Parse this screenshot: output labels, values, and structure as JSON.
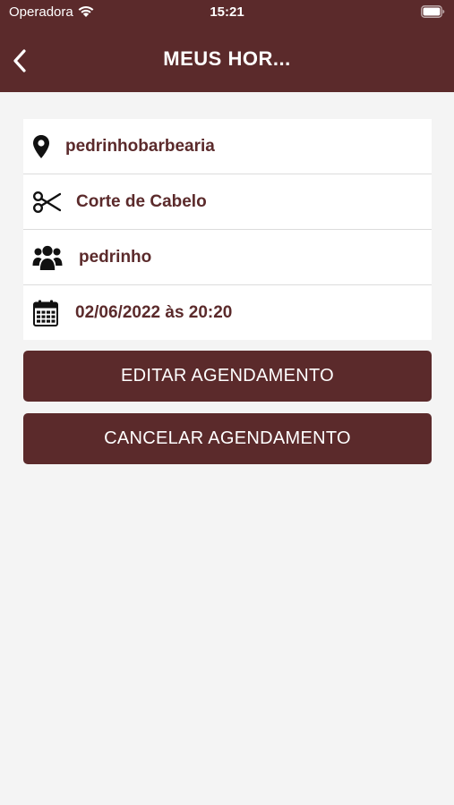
{
  "status_bar": {
    "carrier": "Operadora",
    "time": "15:21"
  },
  "nav": {
    "title": "MEUS HOR..."
  },
  "details": {
    "location": "pedrinhobarbearia",
    "service": "Corte de Cabelo",
    "professional": "pedrinho",
    "datetime": "02/06/2022 às 20:20"
  },
  "actions": {
    "edit_label": "EDITAR AGENDAMENTO",
    "cancel_label": "CANCELAR AGENDAMENTO"
  },
  "icons": {
    "location": "map-pin-icon",
    "service": "scissors-icon",
    "professional": "users-icon",
    "datetime": "calendar-icon"
  },
  "colors": {
    "primary": "#5b2a2b",
    "background": "#f4f4f4",
    "card": "#ffffff",
    "text_on_primary": "#ffffff"
  }
}
